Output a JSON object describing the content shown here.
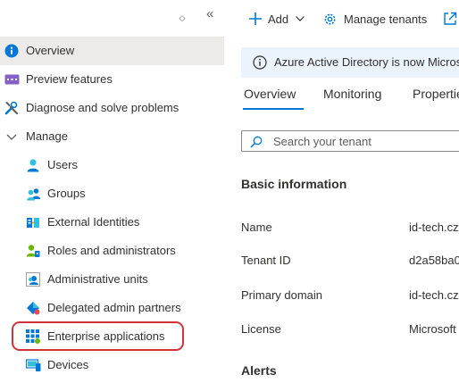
{
  "sidebar": {
    "items": [
      {
        "label": "Overview",
        "icon": "info-icon"
      },
      {
        "label": "Preview features",
        "icon": "preview-features-icon"
      },
      {
        "label": "Diagnose and solve problems",
        "icon": "wrench-icon"
      },
      {
        "label": "Manage",
        "icon": "chevron-down-icon"
      },
      {
        "label": "Users",
        "icon": "user-icon"
      },
      {
        "label": "Groups",
        "icon": "groups-icon"
      },
      {
        "label": "External Identities",
        "icon": "external-identities-icon"
      },
      {
        "label": "Roles and administrators",
        "icon": "roles-icon"
      },
      {
        "label": "Administrative units",
        "icon": "administrative-units-icon"
      },
      {
        "label": "Delegated admin partners",
        "icon": "delegated-admin-icon"
      },
      {
        "label": "Enterprise applications",
        "icon": "enterprise-apps-icon"
      },
      {
        "label": "Devices",
        "icon": "devices-icon"
      }
    ],
    "selected": "Overview",
    "highlighted": "Enterprise applications"
  },
  "toolbar": {
    "add_label": "Add",
    "manage_tenants_label": "Manage tenants"
  },
  "banner": {
    "text": "Azure Active Directory is now Microsoft Entra ID"
  },
  "tabs": [
    {
      "label": "Overview",
      "active": true
    },
    {
      "label": "Monitoring",
      "active": false
    },
    {
      "label": "Properties",
      "active": false
    }
  ],
  "search": {
    "placeholder": "Search your tenant"
  },
  "basic_info": {
    "heading": "Basic information",
    "rows": [
      {
        "label": "Name",
        "value": "id-tech.cz"
      },
      {
        "label": "Tenant ID",
        "value": "d2a58ba0"
      },
      {
        "label": "Primary domain",
        "value": "id-tech.cz"
      },
      {
        "label": "License",
        "value": "Microsoft"
      }
    ]
  },
  "alerts": {
    "heading": "Alerts"
  },
  "colors": {
    "accent": "#0078d4",
    "selected_bg": "#edebe9",
    "banner_bg": "#ebf3fc",
    "highlight_ring": "#d13438"
  }
}
